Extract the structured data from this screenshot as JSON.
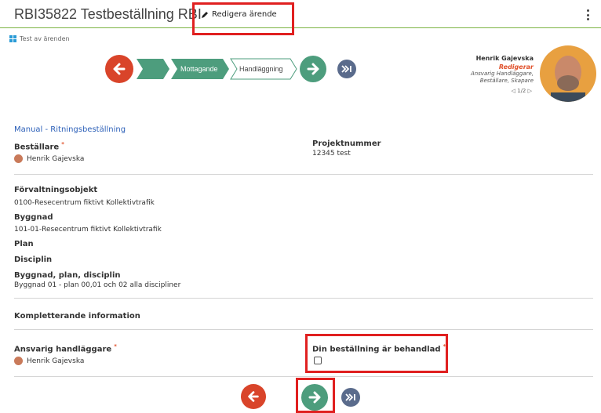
{
  "header": {
    "title": "RBI35822 Testbeställning RBI",
    "edit_label": "Redigera ärende"
  },
  "breadcrumb": {
    "label": "Test av ärenden"
  },
  "workflow": {
    "steps": [
      "Mottagande",
      "Handläggning"
    ],
    "active_step": 0
  },
  "user": {
    "name": "Henrik Gajevska",
    "status": "Redigerar",
    "roles_line1": "Ansvarig Handläggare,",
    "roles_line2": "Beställare, Skapare",
    "pager": "1/2"
  },
  "form": {
    "manual_link": "Manual - Ritningsbeställning",
    "bestallare_label": "Beställare",
    "bestallare_value": "Henrik Gajevska",
    "projektnummer_label": "Projektnummer",
    "projektnummer_value": "12345 test",
    "forvaltningsobjekt_label": "Förvaltningsobjekt",
    "forvaltningsobjekt_value": "0100-Resecentrum fiktivt Kollektivtrafik",
    "byggnad_label": "Byggnad",
    "byggnad_value": "101-01-Resecentrum fiktivt Kollektivtrafik",
    "plan_label": "Plan",
    "disciplin_label": "Disciplin",
    "bpd_label": "Byggnad, plan, disciplin",
    "bpd_value": "Byggnad 01 - plan 00,01 och 02 alla discipliner",
    "komplett_label": "Kompletterande information",
    "ansvarig_label": "Ansvarig handläggare",
    "ansvarig_value": "Henrik Gajevska",
    "behandlad_label": "Din beställning är behandlad",
    "required_mark": "*"
  },
  "colors": {
    "accent_green": "#4d9d7d",
    "back_red": "#d9442a",
    "skip_navy": "#5a6b8c",
    "highlight_red": "#e02020",
    "header_line": "#7bb342"
  }
}
